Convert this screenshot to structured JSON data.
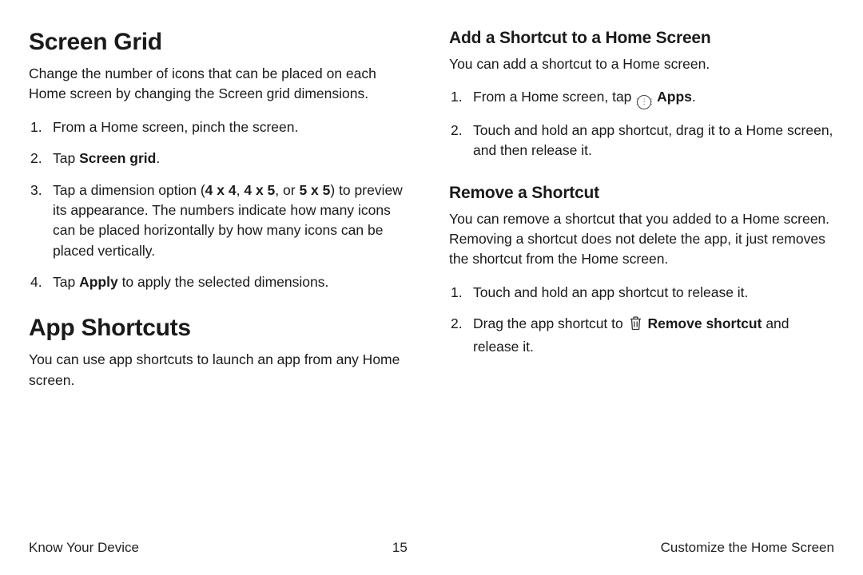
{
  "left": {
    "section1": {
      "heading": "Screen Grid",
      "intro": "Change the number of icons that can be placed on each Home screen by changing the Screen grid dimensions.",
      "steps": {
        "s1": "From a Home screen, pinch the screen.",
        "s2_pre": "Tap ",
        "s2_bold": "Screen grid",
        "s2_post": ".",
        "s3_pre": "Tap a dimension option (",
        "s3_b1": "4 x 4",
        "s3_mid1": ", ",
        "s3_b2": "4 x 5",
        "s3_mid2": ", or ",
        "s3_b3": "5 x 5",
        "s3_post": ") to preview its appearance. The numbers indicate how many icons can be placed horizontally by how many icons can be placed vertically.",
        "s4_pre": "Tap ",
        "s4_bold": "Apply",
        "s4_post": " to apply the selected dimensions."
      }
    },
    "section2": {
      "heading": "App Shortcuts",
      "intro": "You can use app shortcuts to launch an app from any Home screen."
    }
  },
  "right": {
    "section1": {
      "heading": "Add a Shortcut to a Home Screen",
      "intro": "You can add a shortcut to a Home screen.",
      "steps": {
        "s1_pre": "From a Home screen, tap ",
        "s1_bold": "Apps",
        "s1_post": ".",
        "s2": "Touch and hold an app shortcut, drag it to a Home screen, and then release it."
      }
    },
    "section2": {
      "heading": "Remove a Shortcut",
      "intro": "You can remove a shortcut that you added to a Home screen. Removing a shortcut does not delete the app, it just removes the shortcut from the Home screen.",
      "steps": {
        "s1": "Touch and hold an app shortcut to release it.",
        "s2_pre": "Drag the app shortcut to ",
        "s2_bold": "Remove shortcut",
        "s2_post": " and release it."
      }
    }
  },
  "footer": {
    "left": "Know Your Device",
    "center": "15",
    "right": "Customize the Home Screen"
  },
  "icons": {
    "apps_glyph": "⋮⋮⋮"
  }
}
